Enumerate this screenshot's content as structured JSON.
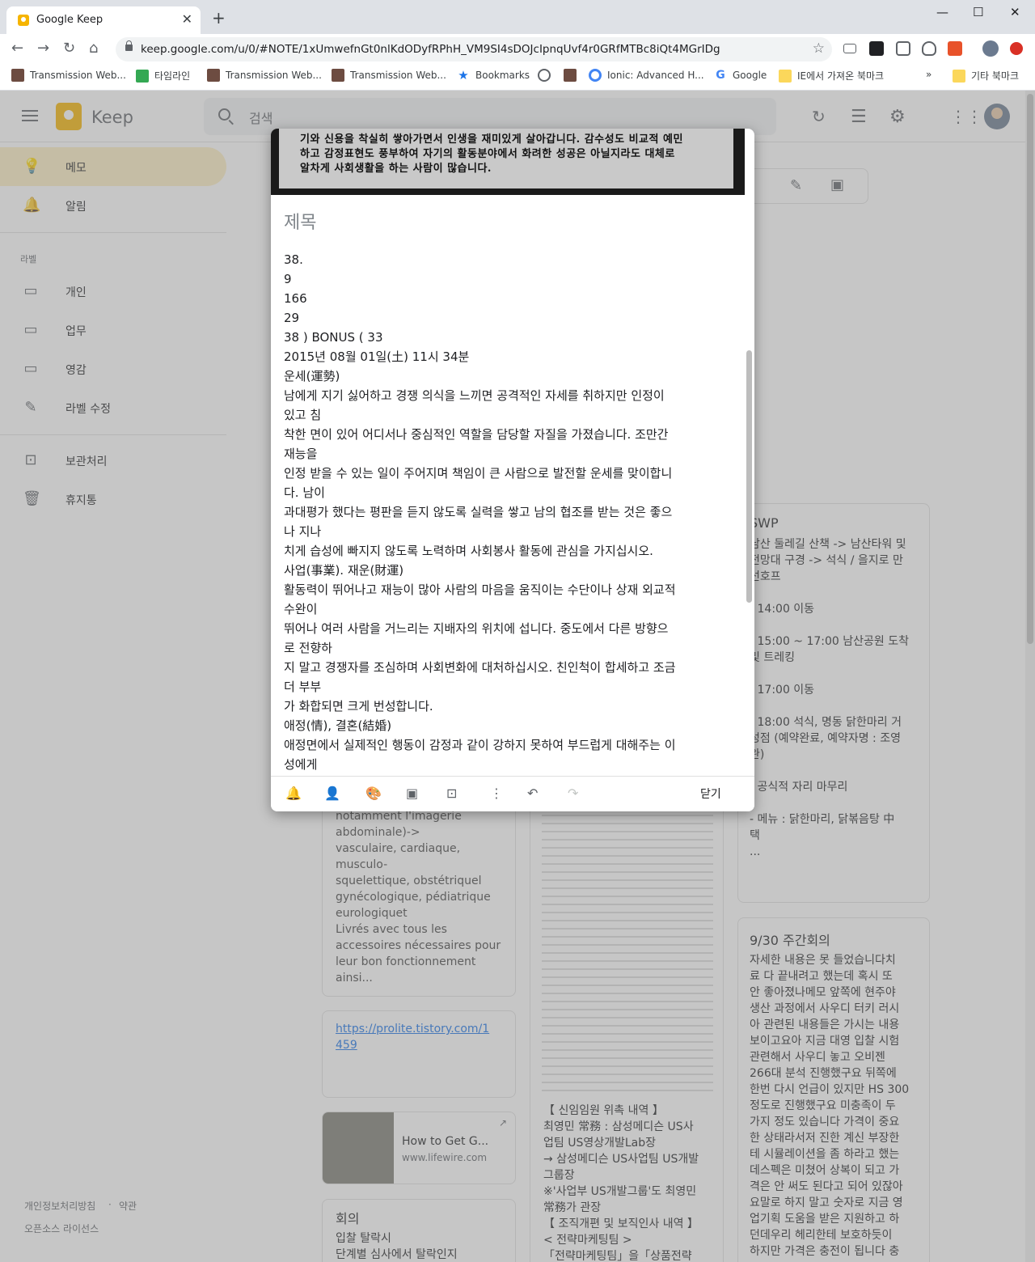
{
  "browser": {
    "tab_title": "Google Keep",
    "url": "keep.google.com/u/0/#NOTE/1xUmwefnGt0nlKdODyfRPhH_VM9SI4sDOJcIpnqUvf4r0GRfMTBc8iQt4MGrIDg",
    "bookmarks": [
      "Transmission Web...",
      "타임라인",
      "Transmission Web...",
      "Transmission Web...",
      "Bookmarks",
      "",
      "",
      "Ionic: Advanced H...",
      "Google",
      "IE에서 가져온 북마크",
      "»",
      "기타 북마크"
    ]
  },
  "keep": {
    "app_name": "Keep",
    "search_placeholder": "검색",
    "sidebar": {
      "items": [
        {
          "label": "메모",
          "icon": "lightbulb-icon"
        },
        {
          "label": "알림",
          "icon": "bell-icon"
        }
      ],
      "labels_heading": "라벨",
      "labels": [
        "개인",
        "업무",
        "영감"
      ],
      "edit_labels": "라벨 수정",
      "archive": "보관처리",
      "trash": "휴지통"
    },
    "footer": {
      "privacy": "개인정보처리방침",
      "sep": "·",
      "terms": "약관",
      "oss": "오픈소스 라이선스"
    }
  },
  "background_notes": {
    "note_fr_text": "notamment l'imagerie\nabdominale)->\nvasculaire, cardiaque, musculo-\nsquelettique, obstétriquel\ngynécologique, pédiatrique\neurologiquet\nLivrés avec tous les\naccessoires nécessaires pour\nleur bon fonctionnement ainsi...",
    "link_text": "https://prolite.tistory.com/1\n459",
    "howto_title": "How to Get G...",
    "howto_domain": "www.lifewire.com",
    "meeting_title": "회의",
    "meeting_text": "입찰 탈락시\n단계별 심사에서 탈락인지",
    "exec_text": "【 신임임원 위촉 내역 】\n최영민 常務 : 삼성메디슨 US사\n업팀 US영상개발Lab장\n→ 삼성메디슨 US사업팀 US개발\n그룹장\n※'사업부 US개발그룹'도 최영민\n常務가 관장\n【 조직개편 및 보직인사 내역 】\n< 전략마케팅팀 >\n「전략마케팅팀」을「상품전략",
    "swp_title": "SWP",
    "swp_text": "남산 둘레길 산책 -> 남산타워 및\n전망대 구경 -> 석식 / 을지로 만\n선호프\n\n- 14:00 이동\n\n- 15:00 ~ 17:00  남산공원 도착\n및 트레킹\n\n- 17:00 이동\n\n- 18:00 석식, 명동 닭한마리 거\n성점 (예약완료, 예약자명 : 조영\n완)\n\n  - 공식적 자리 마무리\n\n  - 메뉴 : 닭한마리, 닭볶음탕 中\n택\n...",
    "weekly_title": "9/30 주간회의",
    "weekly_text": "자세한 내용은 못 들었습니다치\n료 다 끝내려고 했는데 혹시 또\n안 좋아졌나메모 앞쪽에 현주야\n생산 과정에서 사우디 터키 러시\n아 관련된 내용들은 가시는 내용\n보이고요아 지금 대영 입찰 시험\n관련해서 사우디 놓고 오비젠\n266대 분석 진행했구요 뒤쪽에\n한번 다시 언급이 있지만 HS 300\n정도로 진행했구요 미충족이 두\n가지 정도 있습니다 가격이 중요\n한 상태라서저 진한 계신 부장한\n테 시뮬레이션을 좀 하라고 했는\n데스펙은 미쳤어 상복이 되고 가\n격은 안 써도 된다고 되어 있잖아\n요말로 하지 말고 숫자로 지금 영\n업기획 도움을 받은 지원하고 하\n던데우리 헤리한테 보호하듯이\n하지만 가격은 충전이 됩니다 충"
  },
  "modal": {
    "image_lines": [
      "기와 신용을 착실히 쌓아가면서 인생을 재미있게 살아갑니다. 감수성도 비교적 예민",
      "하고 감정표현도 풍부하여 자기의 활동분야에서 화려한 성공은 아닐지라도 대체로",
      "알차게 사회생활을 하는 사람이 많습니다."
    ],
    "title_placeholder": "제목",
    "body_lines": [
      "38.",
      "9",
      "166",
      "29",
      "38 ) BONUS ( 33",
      "2015년 08월 01일(土) 11시 34분",
      "운세(運勢)",
      "남에게 지기 싫어하고 경쟁 의식을 느끼면 공격적인 자세를 취하지만 인정이",
      "있고 침",
      "착한 면이 있어 어디서나 중심적인 역할을 담당할 자질을 가졌습니다. 조만간",
      "재능을",
      "인정 받을 수 있는 일이 주어지며 책임이 큰 사람으로 발전할 운세를 맞이합니",
      "다. 남이",
      "과대평가 했다는 평판을 듣지 않도록 실력을 쌓고 남의 협조를 받는 것은 좋으",
      "나 지나",
      "치게 습성에 빠지지 않도록 노력하며 사회봉사 활동에 관심을 가지십시오.",
      "사업(事業). 재운(財運)",
      "활동력이 뛰어나고 재능이 많아 사람의 마음을 움직이는 수단이나 상재 외교적",
      "수완이",
      "뛰어나 여러 사람을 거느리는 지배자의 위치에 섭니다. 중도에서 다른 방향으",
      "로 전향하",
      "지 말고 경쟁자를 조심하며 사회변화에 대처하십시오. 친인척이 합세하고 조금",
      "더 부부",
      "가 화합되면 크게 번성합니다.",
      "애정(情), 결혼(結婚)",
      "애정면에서 실제적인 행동이 감정과 같이 강하지 못하여 부드럽게 대해주는 이",
      "성에게"
    ],
    "close_label": "닫기"
  }
}
